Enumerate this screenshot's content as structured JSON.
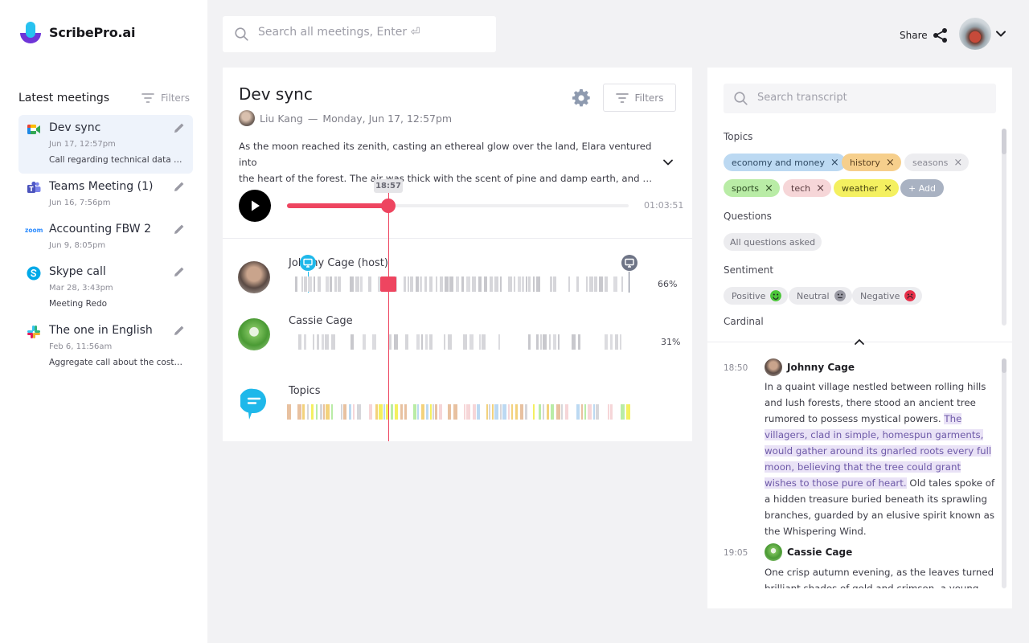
{
  "app": {
    "name": "ScribePro.ai"
  },
  "sidebar": {
    "heading": "Latest meetings",
    "filters_label": "Filters",
    "meetings": [
      {
        "title": "Dev sync",
        "date": "Jun 17, 12:57pm",
        "description": "Call regarding technical data a...",
        "icon": "google-meet-icon",
        "active": true
      },
      {
        "title": "Teams Meeting (1)",
        "date": "Jun 16, 7:56pm",
        "description": "",
        "icon": "ms-teams-icon",
        "active": false
      },
      {
        "title": "Accounting FBW 2",
        "date": "Jun 9, 8:05pm",
        "description": "",
        "icon": "zoom-icon",
        "icon_text": "zoom",
        "active": false
      },
      {
        "title": "Skype call",
        "date": "Mar 28, 3:43pm",
        "description": "Meeting Redo",
        "icon": "skype-icon",
        "active": false
      },
      {
        "title": "The one in English",
        "date": "Feb 6, 11:56am",
        "description": "Aggregate call about the cost ...",
        "icon": "slack-icon",
        "active": false
      }
    ]
  },
  "header": {
    "search_placeholder": "Search all meetings, Enter ⏎",
    "share_label": "Share"
  },
  "meeting": {
    "title": "Dev sync",
    "organizer": "Liu Kang",
    "datetime": "Monday, Jun 17, 12:57pm",
    "separator": "—",
    "filters_label": "Filters",
    "description_line1": "As the moon reached its zenith, casting an ethereal glow over the land, Elara ventured into",
    "description_line2": "the heart of the forest. The air was thick with the scent of pine and damp earth, and the only sound was the rustle",
    "player": {
      "current_time": "18:57",
      "duration": "01:03:51",
      "progress": 0.2965
    },
    "speakers": [
      {
        "name": "Johnny Cage (host)",
        "percent": "66%"
      },
      {
        "name": "Cassie Cage",
        "percent": "31%"
      }
    ],
    "topics_label": "Topics"
  },
  "transcript_panel": {
    "search_placeholder": "Search transcript",
    "topics_heading": "Topics",
    "topics": [
      {
        "label": "economy and money",
        "bg": "#bcd9f2",
        "fg": "#2f4a64",
        "removable": true
      },
      {
        "label": "history",
        "bg": "#f6cf8c",
        "fg": "#5a4020",
        "removable": true
      },
      {
        "label": "seasons",
        "bg": "#ededf0",
        "fg": "#8a8a94",
        "removable": true
      },
      {
        "label": "sports",
        "bg": "#b9eca6",
        "fg": "#2c4a22",
        "removable": true
      },
      {
        "label": "tech",
        "bg": "#f6d6d8",
        "fg": "#5a3a3e",
        "removable": true
      },
      {
        "label": "weather",
        "bg": "#f4f060",
        "fg": "#4a4612",
        "removable": true
      }
    ],
    "add_label": "+ Add",
    "questions_heading": "Questions",
    "questions_pill": "All questions asked",
    "sentiment_heading": "Sentiment",
    "sentiments": [
      {
        "label": "Positive",
        "color": "#4cc63a"
      },
      {
        "label": "Neutral",
        "color": "#9a9aa4"
      },
      {
        "label": "Negative",
        "color": "#e8304a"
      }
    ],
    "cardinal_heading": "Cardinal",
    "segments": [
      {
        "time": "18:50",
        "speaker": "Johnny Cage",
        "text_before": "In a quaint village nestled between rolling hills and lush forests, there stood an ancient tree rumored to possess mystical powers. ",
        "text_highlight": "The villagers, clad in simple, homespun garments, would gather around its gnarled roots every full moon, believing that the tree could grant wishes to those pure of heart.",
        "text_after": " Old tales spoke of a hidden treasure buried beneath its sprawling branches, guarded by an elusive spirit known as the Whispering Wind."
      },
      {
        "time": "19:05",
        "speaker": "Cassie Cage",
        "text_before": "One crisp autumn evening, as the leaves turned brilliant shades of gold and crimson, a young",
        "text_highlight": "",
        "text_after": ""
      }
    ]
  }
}
